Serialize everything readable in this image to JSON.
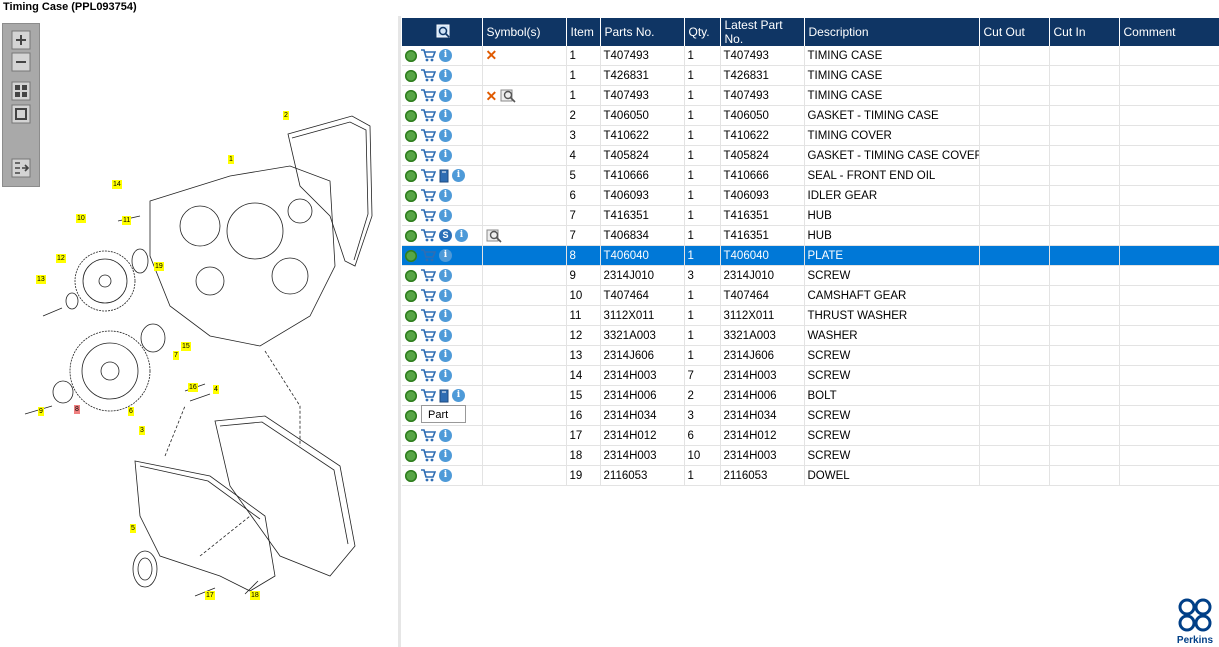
{
  "window": {
    "title": "Timing Case (PPL093754)"
  },
  "columns": [
    "",
    "Symbol(s)",
    "Item",
    "Parts No.",
    "Qty.",
    "Latest Part No.",
    "Description",
    "Cut Out",
    "Cut In",
    "Comment"
  ],
  "rows": [
    {
      "item": "1",
      "part": "T407493",
      "qty": "1",
      "latest": "T407493",
      "desc": "TIMING CASE",
      "symbols": [
        "cross"
      ],
      "extra": []
    },
    {
      "item": "1",
      "part": "T426831",
      "qty": "1",
      "latest": "T426831",
      "desc": "TIMING CASE",
      "symbols": [],
      "extra": []
    },
    {
      "item": "1",
      "part": "T407493",
      "qty": "1",
      "latest": "T407493",
      "desc": "TIMING CASE",
      "symbols": [
        "cross",
        "magnifier"
      ],
      "extra": []
    },
    {
      "item": "2",
      "part": "T406050",
      "qty": "1",
      "latest": "T406050",
      "desc": "GASKET - TIMING CASE",
      "symbols": [],
      "extra": []
    },
    {
      "item": "3",
      "part": "T410622",
      "qty": "1",
      "latest": "T410622",
      "desc": "TIMING COVER",
      "symbols": [],
      "extra": []
    },
    {
      "item": "4",
      "part": "T405824",
      "qty": "1",
      "latest": "T405824",
      "desc": "GASKET - TIMING CASE COVER",
      "symbols": [],
      "extra": []
    },
    {
      "item": "5",
      "part": "T410666",
      "qty": "1",
      "latest": "T410666",
      "desc": "SEAL - FRONT END OIL",
      "symbols": [],
      "extra": [
        "book"
      ]
    },
    {
      "item": "6",
      "part": "T406093",
      "qty": "1",
      "latest": "T406093",
      "desc": "IDLER GEAR",
      "symbols": [],
      "extra": []
    },
    {
      "item": "7",
      "part": "T416351",
      "qty": "1",
      "latest": "T416351",
      "desc": "HUB",
      "symbols": [],
      "extra": []
    },
    {
      "item": "7",
      "part": "T406834",
      "qty": "1",
      "latest": "T416351",
      "desc": "HUB",
      "symbols": [
        "magnifier"
      ],
      "extra": [
        "s"
      ]
    },
    {
      "item": "8",
      "part": "T406040",
      "qty": "1",
      "latest": "T406040",
      "desc": "PLATE",
      "symbols": [],
      "extra": [],
      "selected": true
    },
    {
      "item": "9",
      "part": "2314J010",
      "qty": "3",
      "latest": "2314J010",
      "desc": "SCREW",
      "symbols": [],
      "extra": []
    },
    {
      "item": "10",
      "part": "T407464",
      "qty": "1",
      "latest": "T407464",
      "desc": "CAMSHAFT GEAR",
      "symbols": [],
      "extra": []
    },
    {
      "item": "11",
      "part": "3112X011",
      "qty": "1",
      "latest": "3112X011",
      "desc": "THRUST WASHER",
      "symbols": [],
      "extra": []
    },
    {
      "item": "12",
      "part": "3321A003",
      "qty": "1",
      "latest": "3321A003",
      "desc": "WASHER",
      "symbols": [],
      "extra": []
    },
    {
      "item": "13",
      "part": "2314J606",
      "qty": "1",
      "latest": "2314J606",
      "desc": "SCREW",
      "symbols": [],
      "extra": []
    },
    {
      "item": "14",
      "part": "2314H003",
      "qty": "7",
      "latest": "2314H003",
      "desc": "SCREW",
      "symbols": [],
      "extra": []
    },
    {
      "item": "15",
      "part": "2314H006",
      "qty": "2",
      "latest": "2314H006",
      "desc": "BOLT",
      "symbols": [],
      "extra": [
        "book"
      ]
    },
    {
      "item": "16",
      "part": "2314H034",
      "qty": "3",
      "latest": "2314H034",
      "desc": "SCREW",
      "symbols": [],
      "extra": []
    },
    {
      "item": "17",
      "part": "2314H012",
      "qty": "6",
      "latest": "2314H012",
      "desc": "SCREW",
      "symbols": [],
      "extra": []
    },
    {
      "item": "18",
      "part": "2314H003",
      "qty": "10",
      "latest": "2314H003",
      "desc": "SCREW",
      "symbols": [],
      "extra": []
    },
    {
      "item": "19",
      "part": "2116053",
      "qty": "1",
      "latest": "2116053",
      "desc": "DOWEL",
      "symbols": [],
      "extra": []
    }
  ],
  "tooltip": "Part",
  "logo": {
    "text": "Perkins"
  },
  "diagram": {
    "callouts": [
      "1",
      "2",
      "3",
      "4",
      "5",
      "6",
      "7",
      "8",
      "9",
      "10",
      "11",
      "12",
      "13",
      "14",
      "15",
      "16",
      "17",
      "18",
      "19"
    ]
  },
  "colors": {
    "header_bg": "#0f3564",
    "selected_row": "#0078d7",
    "callout": "#ffff00",
    "callout_selected": "#f08080"
  }
}
